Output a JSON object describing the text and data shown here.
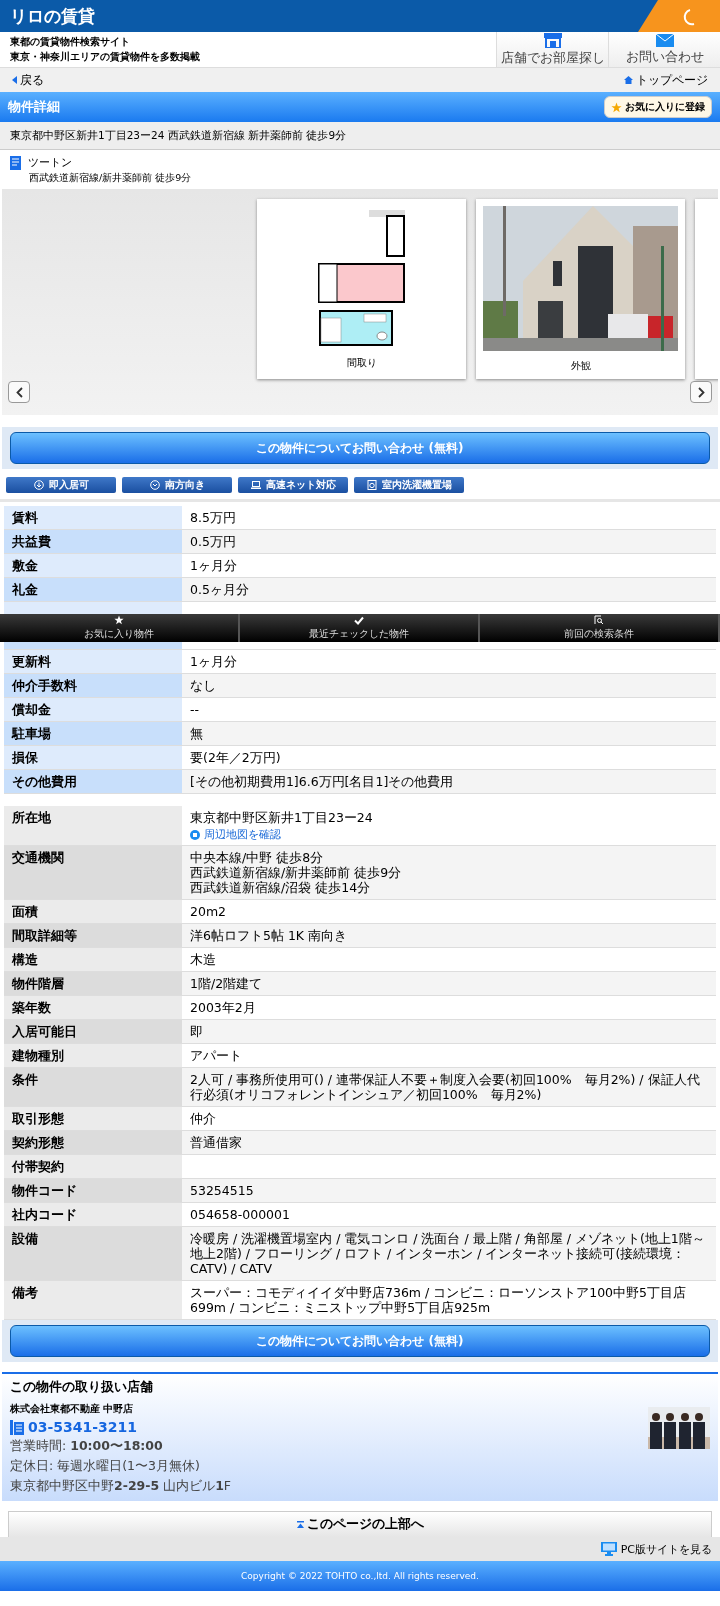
{
  "header": {
    "logo": "リロの賃貸",
    "site_title": "東都の賃貸物件検索サイト",
    "site_subtitle": "東京・神奈川エリアの賃貸物件を多数掲載",
    "nav": [
      {
        "kind": "store",
        "label": "店舗でお部屋探し"
      },
      {
        "kind": "mail",
        "label": "お問い合わせ"
      }
    ]
  },
  "breadcrumb": {
    "back": "戻る",
    "top": "トップページ"
  },
  "title_bar": {
    "title": "物件詳細",
    "favorite_button": "お気に入りに登録"
  },
  "address_line": "東京都中野区新井1丁目23ー24 西武鉄道新宿線 新井薬師前 徒歩9分",
  "property": {
    "name": "ツートン",
    "access": "西武鉄道新宿線/新井薬師前 徒歩9分"
  },
  "gallery": {
    "items": [
      {
        "kind": "floorplan",
        "caption": "間取り"
      },
      {
        "kind": "picture",
        "caption": "外観"
      },
      {
        "kind": "partial"
      }
    ]
  },
  "inquiry_button": "この物件についてお問い合わせ (無料)",
  "features": [
    {
      "kind": "home",
      "label": "即入居可"
    },
    {
      "kind": "south",
      "label": "南方向き"
    },
    {
      "kind": "net",
      "label": "高速ネット対応"
    },
    {
      "kind": "washer",
      "label": "室内洗濯機置場"
    }
  ],
  "fees": [
    {
      "label": "賃料",
      "value": "8.5万円"
    },
    {
      "label": "共益費",
      "value": "0.5万円"
    },
    {
      "label": "敷金",
      "value": "1ヶ月分"
    },
    {
      "label": "礼金",
      "value": "0.5ヶ月分"
    },
    {
      "kind": "hidden"
    },
    {
      "kind": "hidden"
    },
    {
      "label": "更新料",
      "value": "1ヶ月分"
    },
    {
      "label": "仲介手数料",
      "value": "なし"
    },
    {
      "label": "償却金",
      "value": "--"
    },
    {
      "label": "駐車場",
      "value": "無"
    },
    {
      "label": "損保",
      "value": "要(2年／2万円)"
    },
    {
      "label": "その他費用",
      "value": "[その他初期費用1]6.6万円[名目1]その他費用"
    }
  ],
  "floating_bar": [
    {
      "kind": "star",
      "label": "お気に入り物件"
    },
    {
      "kind": "check",
      "label": "最近チェックした物件"
    },
    {
      "kind": "search",
      "label": "前回の検索条件"
    }
  ],
  "details": [
    {
      "label": "所在地",
      "lines": [
        "東京都中野区新井1丁目23ー24"
      ],
      "link": "周辺地図を確認"
    },
    {
      "label": "交通機関",
      "lines": [
        "中央本線/中野 徒歩8分",
        "西武鉄道新宿線/新井薬師前 徒歩9分",
        "西武鉄道新宿線/沼袋 徒歩14分"
      ]
    },
    {
      "label": "面積",
      "lines": [
        "20m2"
      ]
    },
    {
      "label": "間取詳細等",
      "lines": [
        "洋6帖ロフト5帖 1K 南向き"
      ]
    },
    {
      "label": "構造",
      "lines": [
        "木造"
      ]
    },
    {
      "label": "物件階層",
      "lines": [
        "1階/2階建て"
      ]
    },
    {
      "label": "築年数",
      "lines": [
        "2003年2月"
      ]
    },
    {
      "label": "入居可能日",
      "lines": [
        "即"
      ]
    },
    {
      "label": "建物種別",
      "lines": [
        "アパート"
      ]
    },
    {
      "label": "条件",
      "lines": [
        "2人可 / 事務所使用可() / 連帯保証人不要＋制度入会要(初回100%　毎月2%) / 保証人代行必須(オリコフォレントインシュア／初回100%　毎月2%)"
      ]
    },
    {
      "label": "取引形態",
      "lines": [
        "仲介"
      ]
    },
    {
      "label": "契約形態",
      "lines": [
        "普通借家"
      ]
    },
    {
      "label": "付帯契約"
    },
    {
      "label": "物件コード",
      "lines": [
        "53254515"
      ]
    },
    {
      "label": "社内コード",
      "lines": [
        "054658-000001"
      ]
    },
    {
      "label": "設備",
      "lines": [
        "冷暖房 / 洗濯機置場室内 / 電気コンロ / 洗面台 / 最上階 / 角部屋 / メゾネット(地上1階～地上2階) / フローリング / ロフト / インターホン / インターネット接続可(接続環境：CATV) / CATV"
      ]
    },
    {
      "label": "備考",
      "lines": [
        "スーパー：コモディイイダ中野店736m / コンビニ：ローソンストア100中野5丁目店699m / コンビニ：ミニストップ中野5丁目店925m"
      ]
    }
  ],
  "inquiry_button_bottom": "この物件についてお問い合わせ (無料)",
  "shop": {
    "heading": "この物件の取り扱い店舗",
    "name": "株式会社東都不動産 中野店",
    "phone": "03-5341-3211",
    "hours": "営業時間: **10:00〜18:00**",
    "holiday": "定休日: 毎週水曜日(1〜3月無休)",
    "address": "東京都中野区中野**2-29-5** 山内ビル**1**F"
  },
  "page_top": "このページの上部へ",
  "pc_site": "PC版サイトを見る",
  "copyright": "Copyright © 2022 TOHTO co.,ltd. All rights reserved."
}
